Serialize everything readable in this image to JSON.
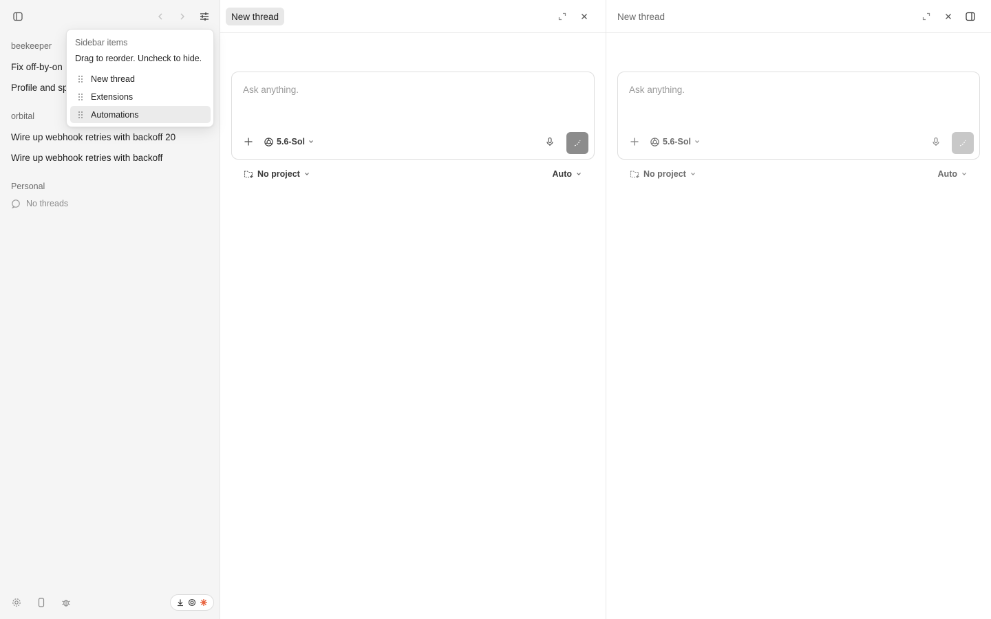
{
  "sidebar": {
    "groups": [
      {
        "label": "beekeeper",
        "threads": [
          "Fix off-by-on",
          "Profile and sp"
        ]
      },
      {
        "label": "orbital",
        "threads": [
          "Wire up webhook retries with backoff 20",
          "Wire up webhook retries with backoff"
        ]
      },
      {
        "label": "Personal",
        "threads": []
      }
    ],
    "empty_label": "No threads",
    "icons": {
      "toggle": "sidebar-toggle-icon",
      "back": "chevron-left-icon",
      "forward": "chevron-right-icon",
      "customize": "sliders-icon",
      "settings": "gear-icon",
      "device": "phone-icon",
      "bug": "bug-icon",
      "download": "download-icon",
      "openai": "openai-logo-icon",
      "spark": "spark-icon"
    }
  },
  "popover": {
    "title": "Sidebar items",
    "description": "Drag to reorder. Uncheck to hide.",
    "items": [
      {
        "label": "New thread"
      },
      {
        "label": "Extensions"
      },
      {
        "label": "Automations"
      }
    ]
  },
  "panes": [
    {
      "title": "New thread",
      "placeholder": "Ask anything.",
      "model": "5.6-Sol",
      "project": "No project",
      "mode": "Auto"
    },
    {
      "title": "New thread",
      "placeholder": "Ask anything.",
      "model": "5.6-Sol",
      "project": "No project",
      "mode": "Auto"
    }
  ],
  "colors": {
    "sidebar_bg": "#f5f5f5",
    "send_button": "#8c8c8c",
    "spark": "#e8613c"
  }
}
